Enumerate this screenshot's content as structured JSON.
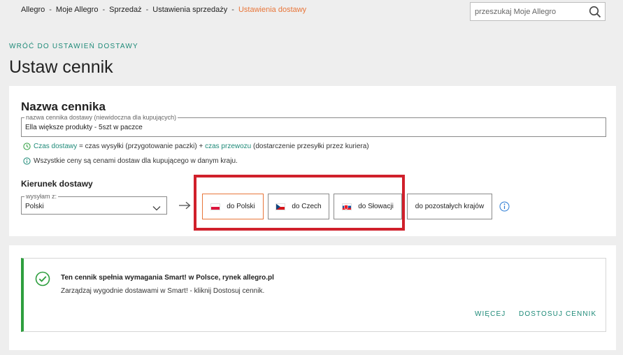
{
  "breadcrumb": {
    "items": [
      "Allegro",
      "Moje Allegro",
      "Sprzedaż",
      "Ustawienia sprzedaży"
    ],
    "separator": "-",
    "current": "Ustawienia dostawy"
  },
  "search": {
    "placeholder": "przeszukaj Moje Allegro",
    "icon": "search-icon"
  },
  "back_link": "WRÓĆ DO USTAWIEŃ DOSTAWY",
  "page_title": "Ustaw cennik",
  "name_section": {
    "title": "Nazwa cennika",
    "field_label": "nazwa cennika dostawy (niewidoczna dla kupujących)",
    "field_value": "Ella większe produkty - 5szt w paczce"
  },
  "info": {
    "line1": {
      "link1": "Czas dostawy",
      "text1": " = czas wysyłki (przygotowanie paczki) + ",
      "link2": "czas przewozu",
      "text2": " (dostarczenie przesyłki przez kuriera)"
    },
    "line2": "Wszystkie ceny są cenami dostaw dla kupującego w danym kraju."
  },
  "direction": {
    "title": "Kierunek dostawy",
    "select_label": "wysyłam z:",
    "select_value": "Polski",
    "countries": [
      {
        "label": "do Polski",
        "flag": "flag-pl"
      },
      {
        "label": "do Czech",
        "flag": "flag-cz"
      },
      {
        "label": "do Słowacji",
        "flag": "flag-sk"
      }
    ],
    "other": "do pozostałych krajów"
  },
  "smart": {
    "title": "Ten cennik spełnia wymagania Smart! w Polsce, rynek allegro.pl",
    "description": "Zarządzaj wygodnie dostawami w Smart! - kliknij Dostosuj cennik.",
    "more": "WIĘCEJ",
    "adjust": "DOSTOSUJ CENNIK"
  },
  "colors": {
    "accent_teal": "#1e8a78",
    "accent_orange": "#e8763a",
    "highlight_red": "#d0202b",
    "success_green": "#2e9e3e"
  }
}
